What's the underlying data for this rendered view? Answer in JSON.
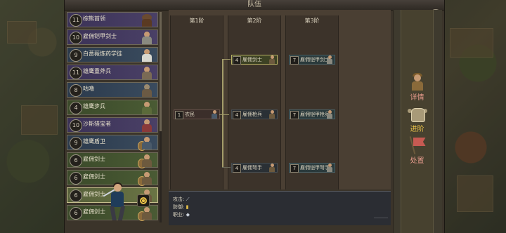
{
  "window": {
    "title": "队伍",
    "close_symbol": "✕"
  },
  "roster": [
    {
      "level": "11",
      "name": "棕熊首领",
      "tier": "purple"
    },
    {
      "level": "10",
      "name": "雇佣铠甲剑士",
      "tier": "purple"
    },
    {
      "level": "9",
      "name": "白蔷薇炼药学徒",
      "tier": "blue"
    },
    {
      "level": "11",
      "name": "雄鹰重斧兵",
      "tier": "purple"
    },
    {
      "level": "8",
      "name": "咕噜",
      "tier": "blue"
    },
    {
      "level": "4",
      "name": "雄鹰步兵",
      "tier": "green"
    },
    {
      "level": "10",
      "name": "沙斯猎宝者",
      "tier": "purple"
    },
    {
      "level": "9",
      "name": "雄鹰盾卫",
      "tier": "blue"
    },
    {
      "level": "6",
      "name": "雇佣剑士",
      "tier": "green"
    },
    {
      "level": "6",
      "name": "雇佣剑士",
      "tier": "green"
    },
    {
      "level": "6",
      "name": "雇佣剑士",
      "tier": "sel"
    },
    {
      "level": "6",
      "name": "雇佣剑士",
      "tier": "green"
    }
  ],
  "tree": {
    "columns": [
      "第1阶",
      "第2阶",
      "第3阶"
    ],
    "nodes": {
      "peasant": {
        "num": "1",
        "name": "农民"
      },
      "c2_top": {
        "num": "4",
        "name": "雇佣剑士"
      },
      "c2_mid": {
        "num": "4",
        "name": "雇佣枪兵"
      },
      "c2_bot": {
        "num": "4",
        "name": "雇佣弩手"
      },
      "c3_top": {
        "num": "7",
        "name": "雇佣铠甲剑士"
      },
      "c3_mid": {
        "num": "7",
        "name": "雇佣铠甲枪兵"
      },
      "c3_bot": {
        "num": "7",
        "name": "雇佣铠甲弩手"
      }
    }
  },
  "detail": {
    "attack": "攻击: ",
    "defense": "防御: ",
    "profession": "职业: "
  },
  "actions": [
    {
      "label": "详情",
      "icon": "soldier-portrait-icon"
    },
    {
      "label": "进阶",
      "icon": "armor-icon"
    },
    {
      "label": "处置",
      "icon": "flag-icon"
    }
  ],
  "colors": {
    "accent_gold": "#e9c24a",
    "label_red": "#e79b8c",
    "selected_border": "#b9b265"
  }
}
